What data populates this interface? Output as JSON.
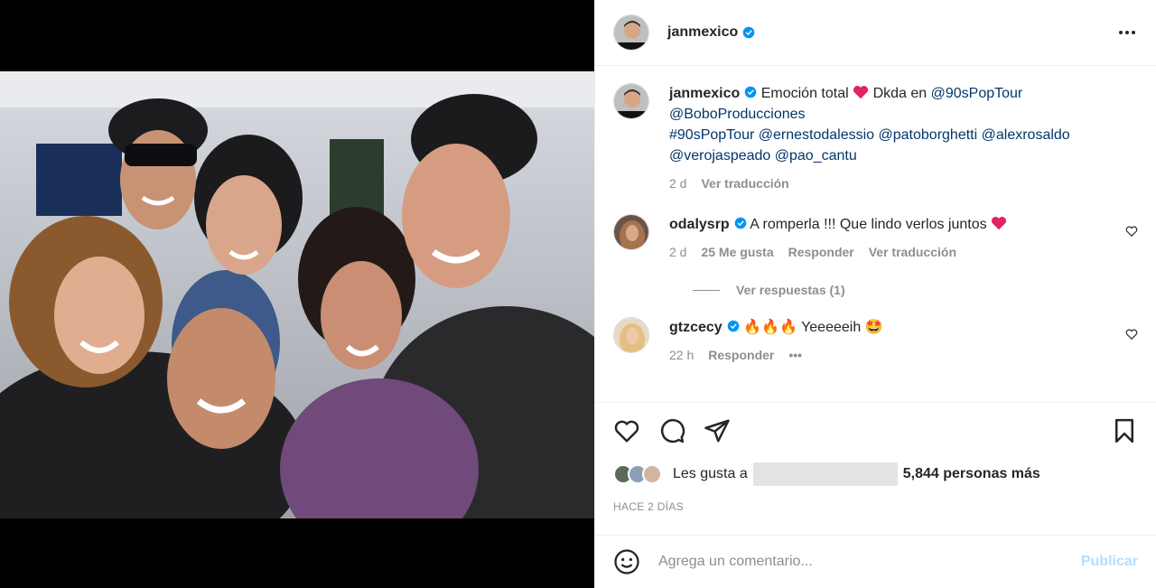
{
  "post": {
    "author": "janmexico",
    "caption": {
      "text_before_heart": "Emoción total",
      "text_after_heart": "Dkda en",
      "mention_1": "@90sPopTour",
      "mention_2": "@BoboProducciones",
      "line3": [
        "#90sPopTour",
        "@ernestodalessio",
        "@patoborghetti",
        "@alexrosaldo"
      ],
      "line4": [
        "@verojaspeado",
        "@pao_cantu"
      ],
      "age": "2 d",
      "translate": "Ver traducción"
    }
  },
  "comments": [
    {
      "username": "odalysrp",
      "text": "A romperla !!! Que lindo verlos juntos",
      "age": "2 d",
      "likes": "25 Me gusta",
      "reply": "Responder",
      "translate": "Ver traducción",
      "view_replies": "Ver respuestas (1)"
    },
    {
      "username": "gtzcecy",
      "text": "Yeeeeeih",
      "age": "22 h",
      "reply": "Responder",
      "more": "•••"
    }
  ],
  "likes": {
    "prefix": "Les gusta a",
    "suffix": "5,844 personas más"
  },
  "date": "HACE 2 DÍAS",
  "comment_input": {
    "placeholder": "Agrega un comentario...",
    "publish": "Publicar"
  },
  "colors": {
    "link": "#00376b",
    "verified": "#0095f6",
    "heart_emoji": "#e0245e",
    "publish_disabled": "#b2dffc",
    "secondary_text": "#8e8e8e"
  },
  "icons": [
    "verified-badge-icon",
    "more-options-icon",
    "heart-icon",
    "comment-icon",
    "share-icon",
    "save-icon",
    "emoji-icon"
  ]
}
